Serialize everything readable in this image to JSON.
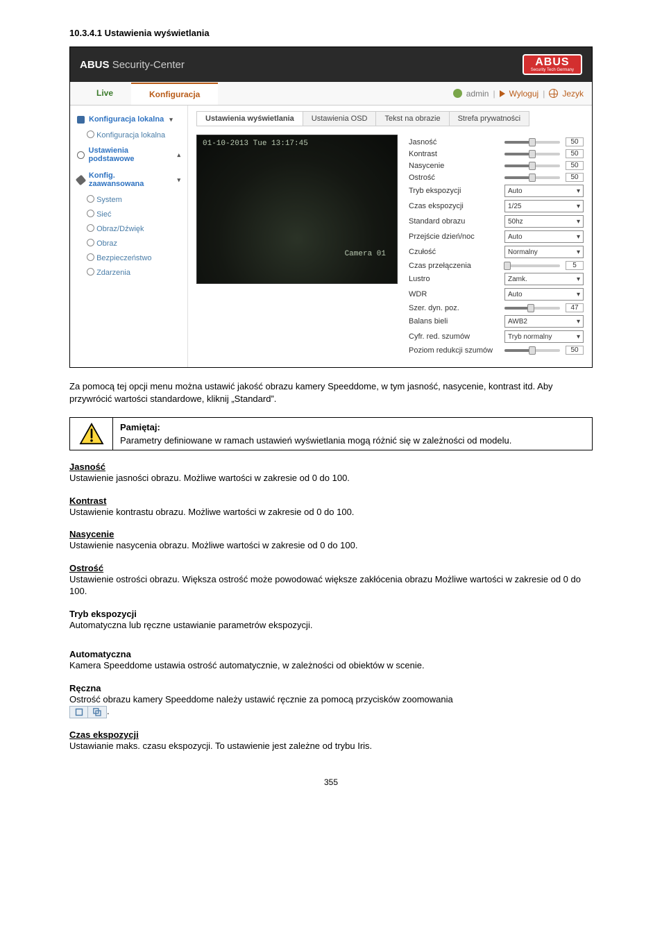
{
  "section_heading": "10.3.4.1 Ustawienia wyświetlania",
  "app": {
    "brand_light": "ABUS",
    "brand_bold": "Security-Center",
    "logo_main": "ABUS",
    "logo_tag": "Security Tech Germany",
    "tabs": {
      "live": "Live",
      "config": "Konfiguracja"
    },
    "userbar": {
      "user": "admin",
      "logout": "Wyloguj",
      "language": "Jezyk"
    }
  },
  "sidebar": {
    "local": "Konfiguracja lokalna",
    "local_sub": "Konfiguracja lokalna",
    "basic": "Ustawienia podstawowe",
    "adv": "Konfig. zaawansowana",
    "items": [
      "System",
      "Sieć",
      "Obraz/Dźwięk",
      "Obraz",
      "Bezpieczeństwo",
      "Zdarzenia"
    ]
  },
  "content_tabs": [
    "Ustawienia wyświetlania",
    "Ustawienia OSD",
    "Tekst na obrazie",
    "Strefa prywatności"
  ],
  "camera": {
    "timestamp": "01-10-2013 Tue 13:17:45",
    "name": "Camera 01"
  },
  "params": {
    "sliders": [
      {
        "label": "Jasność",
        "value": 50,
        "pct": 50
      },
      {
        "label": "Kontrast",
        "value": 50,
        "pct": 50
      },
      {
        "label": "Nasycenie",
        "value": 50,
        "pct": 50
      },
      {
        "label": "Ostrość",
        "value": 50,
        "pct": 50
      }
    ],
    "selects": [
      {
        "label": "Tryb ekspozycji",
        "value": "Auto"
      },
      {
        "label": "Czas ekspozycji",
        "value": "1/25"
      },
      {
        "label": "Standard obrazu",
        "value": "50hz"
      },
      {
        "label": "Przejście dzień/noc",
        "value": "Auto"
      },
      {
        "label": "Czułość",
        "value": "Normalny"
      }
    ],
    "switch_time": {
      "label": "Czas przełączenia",
      "value": 5,
      "pct": 5
    },
    "selects2": [
      {
        "label": "Lustro",
        "value": "Zamk."
      },
      {
        "label": "WDR",
        "value": "Auto"
      }
    ],
    "wdr_range": {
      "label": "Szer. dyn. poz.",
      "value": 47,
      "pct": 47
    },
    "selects3": [
      {
        "label": "Balans bieli",
        "value": "AWB2"
      },
      {
        "label": "Cyfr. red. szumów",
        "value": "Tryb normalny"
      }
    ],
    "noise_lvl": {
      "label": "Poziom redukcji szumów",
      "value": 50,
      "pct": 50
    }
  },
  "intro_para": "Za pomocą tej opcji menu można ustawić jakość obrazu kamery Speeddome, w tym jasność, nasycenie, kontrast itd. Aby przywrócić wartości standardowe, kliknij „Standard”.",
  "note": {
    "heading": "Pamiętaj:",
    "body": "Parametry definiowane w ramach ustawień wyświetlania mogą różnić się w zależności od modelu."
  },
  "defs": [
    {
      "h": "Jasność",
      "u": true,
      "b": "Ustawienie jasności obrazu. Możliwe wartości w zakresie od 0 do 100."
    },
    {
      "h": "Kontrast",
      "u": true,
      "b": "Ustawienie kontrastu obrazu. Możliwe wartości w zakresie od 0 do 100."
    },
    {
      "h": "Nasycenie",
      "u": true,
      "b": "Ustawienie nasycenia obrazu. Możliwe wartości w zakresie od 0 do 100."
    },
    {
      "h": "Ostrość",
      "u": true,
      "b": "Ustawienie ostrości obrazu. Większa ostrość może powodować większe zakłócenia obrazu Możliwe wartości w zakresie od 0 do 100."
    },
    {
      "h": "Tryb ekspozycji",
      "u": false,
      "b": "Automatyczna lub ręczne ustawianie parametrów ekspozycji."
    },
    {
      "h": "Automatyczna",
      "u": false,
      "b": "Kamera Speeddome ustawia ostrość automatycznie, w zależności od obiektów w scenie."
    }
  ],
  "manual": {
    "h": "Ręczna",
    "line": "Ostrość obrazu kamery Speeddome należy ustawić ręcznie za pomocą przycisków zoomowania",
    "tail": "."
  },
  "exposure_time": {
    "h": "Czas ekspozycji",
    "b": "Ustawianie maks. czasu ekspozycji. To ustawienie jest zależne od trybu Iris."
  },
  "page_number": "355",
  "chart_data": {
    "type": "table",
    "title": "Ustawienia wyświetlania (camera image parameters)",
    "rows": [
      {
        "parameter": "Jasność",
        "control": "slider",
        "value": 50,
        "range": [
          0,
          100
        ]
      },
      {
        "parameter": "Kontrast",
        "control": "slider",
        "value": 50,
        "range": [
          0,
          100
        ]
      },
      {
        "parameter": "Nasycenie",
        "control": "slider",
        "value": 50,
        "range": [
          0,
          100
        ]
      },
      {
        "parameter": "Ostrość",
        "control": "slider",
        "value": 50,
        "range": [
          0,
          100
        ]
      },
      {
        "parameter": "Tryb ekspozycji",
        "control": "select",
        "value": "Auto"
      },
      {
        "parameter": "Czas ekspozycji",
        "control": "select",
        "value": "1/25"
      },
      {
        "parameter": "Standard obrazu",
        "control": "select",
        "value": "50hz"
      },
      {
        "parameter": "Przejście dzień/noc",
        "control": "select",
        "value": "Auto"
      },
      {
        "parameter": "Czułość",
        "control": "select",
        "value": "Normalny"
      },
      {
        "parameter": "Czas przełączenia",
        "control": "slider",
        "value": 5
      },
      {
        "parameter": "Lustro",
        "control": "select",
        "value": "Zamk."
      },
      {
        "parameter": "WDR",
        "control": "select",
        "value": "Auto"
      },
      {
        "parameter": "Szer. dyn. poz.",
        "control": "slider",
        "value": 47
      },
      {
        "parameter": "Balans bieli",
        "control": "select",
        "value": "AWB2"
      },
      {
        "parameter": "Cyfr. red. szumów",
        "control": "select",
        "value": "Tryb normalny"
      },
      {
        "parameter": "Poziom redukcji szumów",
        "control": "slider",
        "value": 50
      }
    ]
  }
}
